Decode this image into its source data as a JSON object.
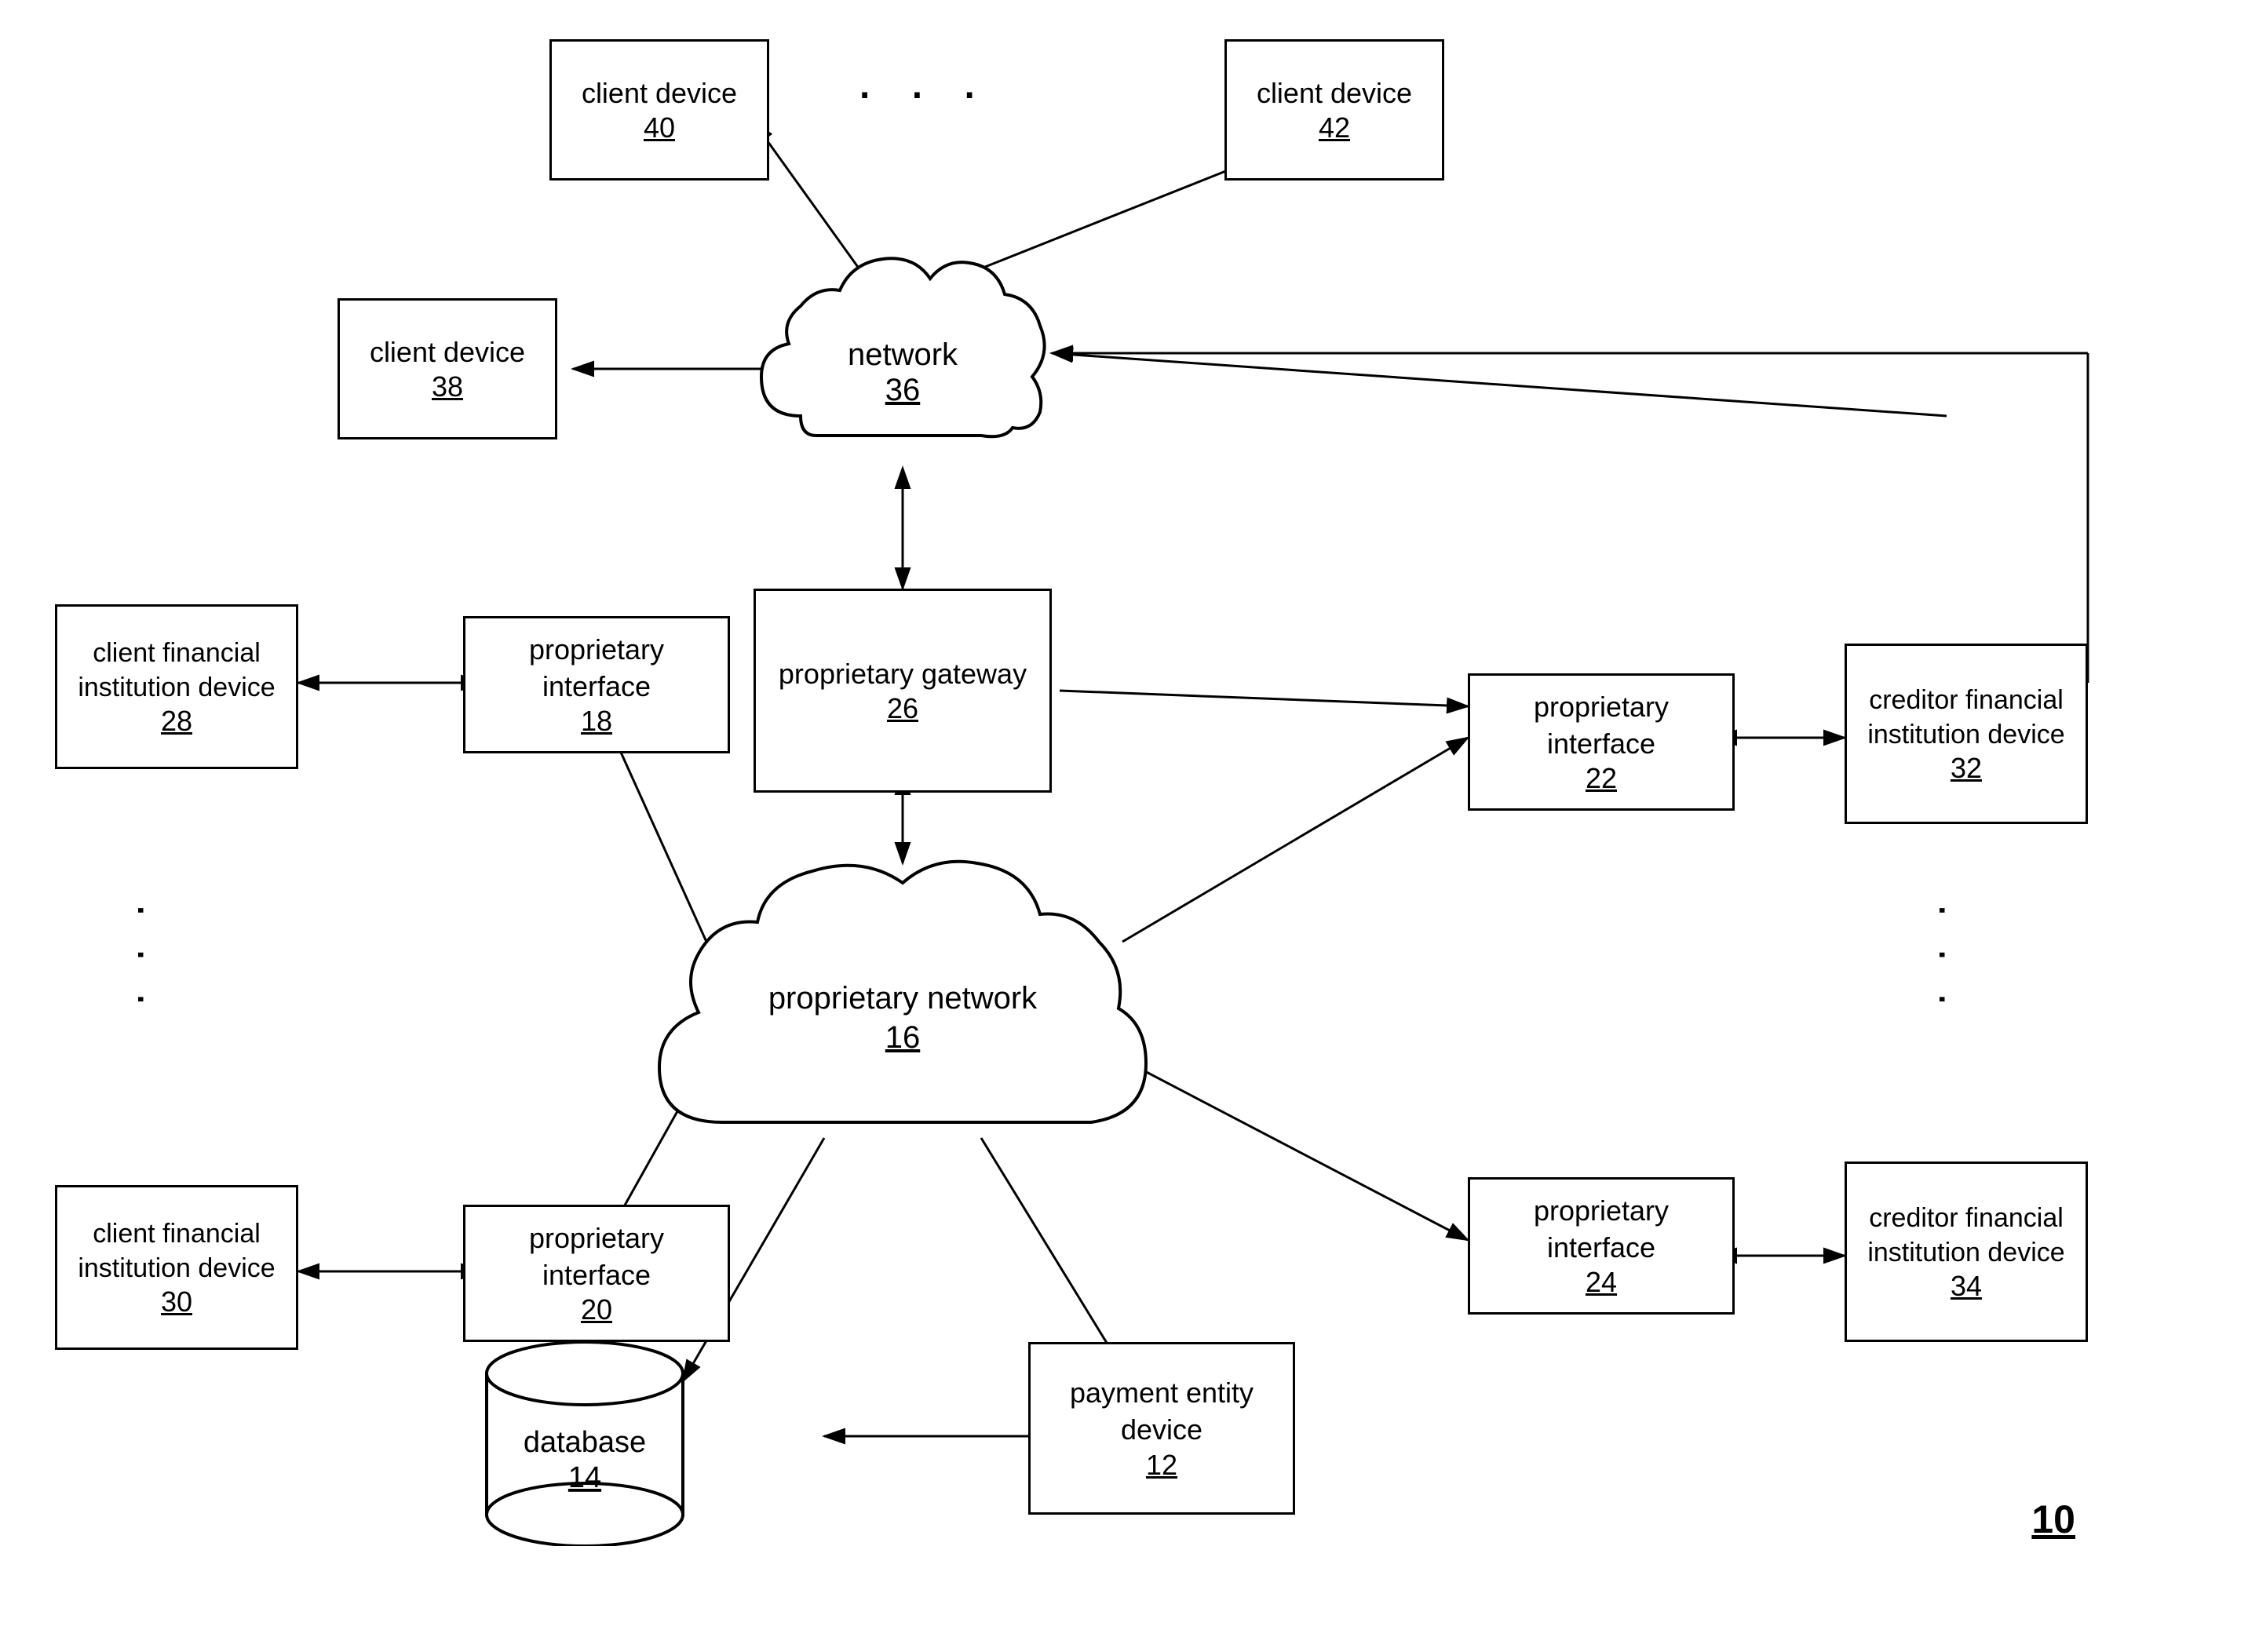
{
  "diagram": {
    "figure_number": "10",
    "nodes": {
      "client_device_40": {
        "label": "client device",
        "num": "40"
      },
      "client_device_42": {
        "label": "client device",
        "num": "42"
      },
      "client_device_38": {
        "label": "client device",
        "num": "38"
      },
      "network_36": {
        "label": "network",
        "num": "36"
      },
      "proprietary_gateway_26": {
        "label": "proprietary gateway",
        "num": "26"
      },
      "proprietary_network_16": {
        "label": "proprietary network",
        "num": "16"
      },
      "proprietary_interface_18": {
        "label": "proprietary interface",
        "num": "18"
      },
      "proprietary_interface_20": {
        "label": "proprietary interface",
        "num": "20"
      },
      "proprietary_interface_22": {
        "label": "proprietary interface",
        "num": "22"
      },
      "proprietary_interface_24": {
        "label": "proprietary interface",
        "num": "24"
      },
      "client_financial_28": {
        "label": "client financial institution device",
        "num": "28"
      },
      "client_financial_30": {
        "label": "client financial institution device",
        "num": "30"
      },
      "creditor_financial_32": {
        "label": "creditor financial institution device",
        "num": "32"
      },
      "creditor_financial_34": {
        "label": "creditor financial institution device",
        "num": "34"
      },
      "payment_entity_12": {
        "label": "payment entity device",
        "num": "12"
      },
      "database_14": {
        "label": "database",
        "num": "14"
      }
    }
  }
}
